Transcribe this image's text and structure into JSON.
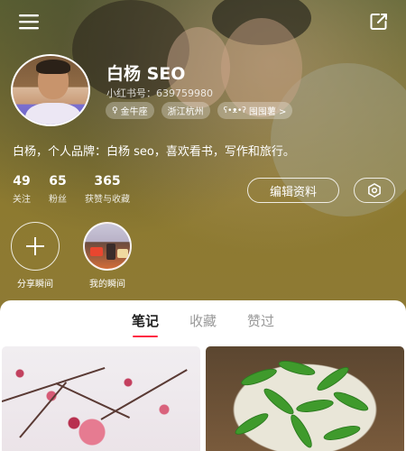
{
  "profile": {
    "username": "白杨 SEO",
    "user_id": "小红书号：639759980",
    "bio": "白杨，个人品牌：白杨 seo，喜欢看书，写作和旅行。",
    "tags": [
      {
        "icon": "female-icon",
        "label": "金牛座"
      },
      {
        "icon": "",
        "label": "浙江杭州"
      },
      {
        "icon": "bear-icon",
        "label": "囤囤薯 >"
      }
    ]
  },
  "stats": [
    {
      "value": "49",
      "label": "关注"
    },
    {
      "value": "65",
      "label": "粉丝"
    },
    {
      "value": "365",
      "label": "获赞与收藏"
    }
  ],
  "actions": {
    "edit_label": "编辑资料",
    "settings_icon": "gear-icon"
  },
  "moments": {
    "share_label": "分享瞬间",
    "mine_label": "我的瞬间"
  },
  "tabs": [
    {
      "label": "笔记",
      "active": true
    },
    {
      "label": "收藏",
      "active": false
    },
    {
      "label": "赞过",
      "active": false
    }
  ],
  "icons": {
    "menu": "menu-icon",
    "share": "share-external-icon"
  },
  "colors": {
    "accent": "#ff2442",
    "header_bg": "#8d7a30"
  }
}
